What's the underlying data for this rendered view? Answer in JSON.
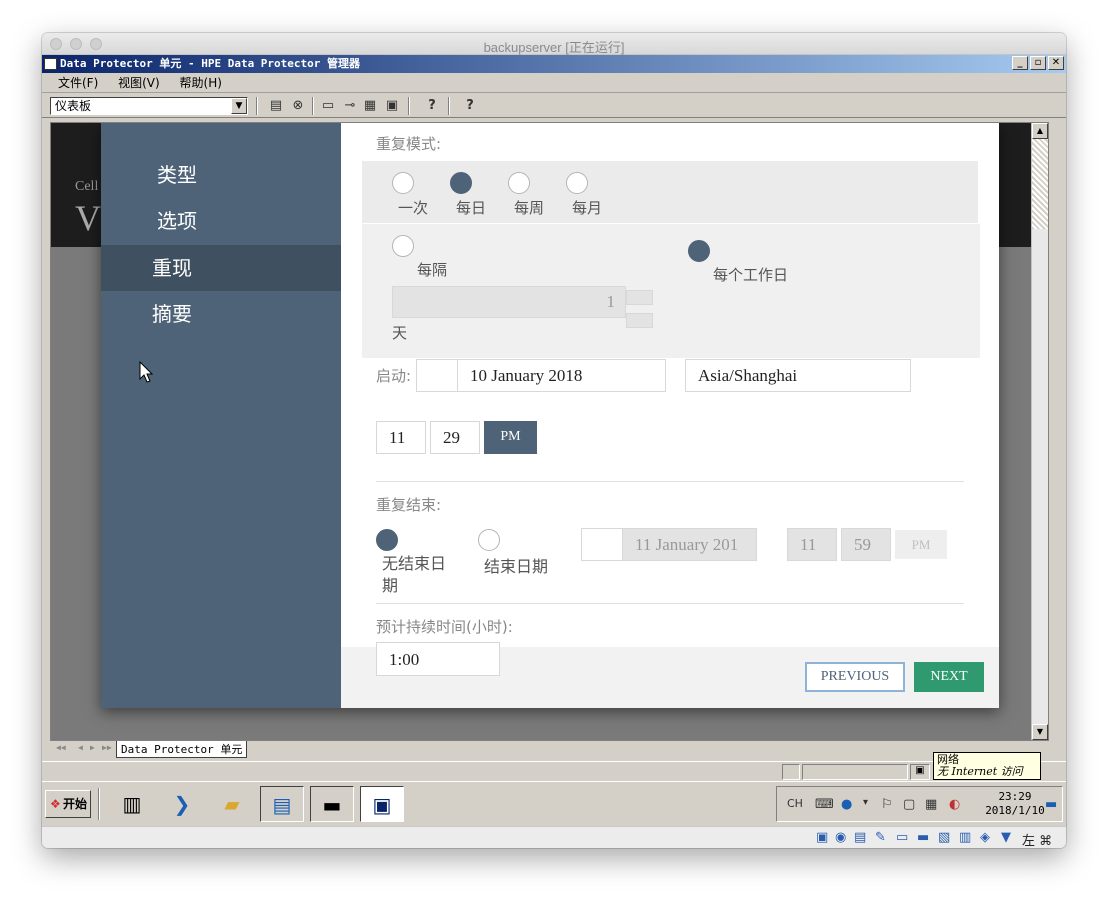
{
  "window": {
    "title": "backupserver [正在运行]"
  },
  "app": {
    "title": "Data Protector 单元 - HPE Data Protector 管理器",
    "win_min": "_",
    "win_max": "▫",
    "win_close": "✕"
  },
  "menu": {
    "items": [
      "文件(F)",
      "视图(V)",
      "帮助(H)"
    ]
  },
  "toolbar": {
    "context": "仪表板",
    "help_label_1": "?",
    "help_label_2": "?"
  },
  "background": {
    "cell_text": "Cell",
    "big_letter": "V"
  },
  "wizard": {
    "steps": [
      "类型",
      "选项",
      "重现",
      "摘要"
    ],
    "active_step": "重现",
    "repeat_mode_label": "重复模式:",
    "modes": [
      "一次",
      "每日",
      "每周",
      "每月"
    ],
    "selected_mode": "每日",
    "every_label": "每隔",
    "workday_label": "每个工作日",
    "interval_value": "1",
    "interval_unit": "天",
    "start_label": "启动:",
    "start_date": "10 January 2018",
    "timezone": "Asia/Shanghai",
    "start_hour": "11",
    "start_minute": "29",
    "start_ampm": "PM",
    "end_label": "重复结束:",
    "no_end_date_label": "无结束日期",
    "end_date_label": "结束日期",
    "end_date_value": "11 January 201",
    "end_hour": "11",
    "end_minute": "59",
    "end_ampm": "PM",
    "duration_label": "预计持续时间(小时):",
    "duration_value": "1:00",
    "previous_label": "PREVIOUS",
    "next_label": "NEXT"
  },
  "tabs": {
    "active": "Data Protector 单元"
  },
  "tooltip": {
    "line1": "网络",
    "line2": "无 Internet 访问"
  },
  "taskbar": {
    "start_label": "开始",
    "lang": "CH",
    "time": "23:29",
    "date": "2018/1/10"
  },
  "mac_status": {
    "key_label": "左 ⌘"
  },
  "colors": {
    "sidebar": "#4f6378",
    "sidebar_active": "#3f5061",
    "next_button": "#2f9a6f",
    "pm_button": "#4f6378"
  }
}
